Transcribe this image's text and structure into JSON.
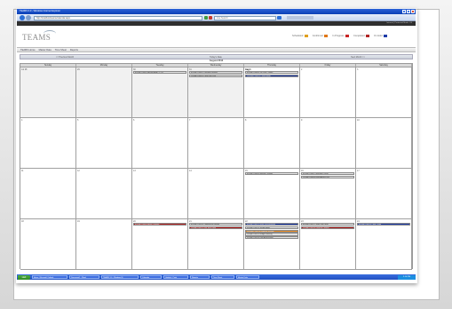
{
  "window": {
    "title": "TEAMS 3.0 - Windows Internet Explorer",
    "url": "http://localhost/teams/calendar.aspx",
    "search_placeholder": "Live Search",
    "status_text": "Internet | Protected Mode: Off"
  },
  "app": {
    "logo": "TEAMS",
    "nav": [
      "TEAMS Home",
      "Master Data",
      "Time Sheet",
      "Reports"
    ],
    "legend": [
      {
        "label": "Scheduled",
        "color": "#e0a020"
      },
      {
        "label": "Confirmed",
        "color": "#e07818"
      },
      {
        "label": "In Progress",
        "color": "#c82424"
      },
      {
        "label": "Completed",
        "color": "#b02424"
      },
      {
        "label": "On Hold",
        "color": "#1f3ca8"
      }
    ]
  },
  "calendar": {
    "prev_label": "<< Previous Month",
    "today_label": "Today's Date",
    "next_label": "Next Month >>",
    "month_title": "August 2013",
    "days": [
      "Sunday",
      "Monday",
      "Tuesday",
      "Wednesday",
      "Thursday",
      "Friday",
      "Saturday"
    ],
    "weeks": [
      {
        "cells": [
          {
            "num": "Jul 28",
            "other": true,
            "events": []
          },
          {
            "num": "29",
            "other": true,
            "events": []
          },
          {
            "num": "30",
            "other": true,
            "events": [
              {
                "text": "8:00am 100001 Annual Audit - FY12",
                "color": "gray"
              }
            ]
          },
          {
            "num": "31",
            "other": true,
            "events": [
              {
                "text": "8:00am 100002 Quarterly Review",
                "color": "gray"
              },
              {
                "text": "1:00pm 100003 Client Site Visit",
                "color": "gray"
              }
            ]
          },
          {
            "num": "Aug 1",
            "today": true,
            "events": [
              {
                "text": "8:00am 100004 Tax Prep - Smith",
                "color": "gray"
              },
              {
                "text": "10:00am 100005 Payroll Audit",
                "color": "blue"
              }
            ]
          },
          {
            "num": "2",
            "events": []
          },
          {
            "num": "3",
            "events": []
          }
        ]
      },
      {
        "cells": [
          {
            "num": "4",
            "events": []
          },
          {
            "num": "5",
            "events": []
          },
          {
            "num": "6",
            "events": []
          },
          {
            "num": "7",
            "events": []
          },
          {
            "num": "8",
            "events": []
          },
          {
            "num": "9",
            "events": []
          },
          {
            "num": "10",
            "events": []
          }
        ]
      },
      {
        "cells": [
          {
            "num": "11",
            "events": []
          },
          {
            "num": "12",
            "events": []
          },
          {
            "num": "13",
            "events": []
          },
          {
            "num": "14",
            "events": []
          },
          {
            "num": "15",
            "events": [
              {
                "text": "8:00am 100006 Internal Controls",
                "color": "gray"
              }
            ]
          },
          {
            "num": "16",
            "events": [
              {
                "text": "8:00am 100007 Inventory Count",
                "color": "gray"
              },
              {
                "text": "1:00pm 100008 Fixed Assets Rev",
                "color": "gray"
              }
            ]
          },
          {
            "num": "17",
            "events": []
          }
        ]
      },
      {
        "cells": [
          {
            "num": "18",
            "events": []
          },
          {
            "num": "19",
            "events": []
          },
          {
            "num": "20",
            "events": [
              {
                "text": "8:00am 100009 Audit Planning",
                "color": "red"
              }
            ]
          },
          {
            "num": "21",
            "events": [
              {
                "text": "8:00am 100010 Compliance Review",
                "color": "gray"
              },
              {
                "text": "1:00pm 100011 Year End Close",
                "color": "red"
              }
            ]
          },
          {
            "num": "22",
            "events": [
              {
                "text": "8:00am 100012 Bank Reconciliation",
                "color": "blue"
              },
              {
                "text": "9:00am 100013 Vendor Audit",
                "color": "gray"
              },
              {
                "text": "10:00am 100014 Expense Review",
                "color": "orange"
              },
              {
                "text": "1:00pm 100015 Budget Meeting",
                "color": "gray"
              },
              {
                "text": "3:00pm 100016 Risk Assessment",
                "color": "gray"
              }
            ]
          },
          {
            "num": "23",
            "events": [
              {
                "text": "8:00am 100017 Sales Tax Filing",
                "color": "gray"
              },
              {
                "text": "1:00pm 100018 Revenue Testing",
                "color": "red"
              }
            ]
          },
          {
            "num": "24",
            "events": [
              {
                "text": "8:00am 100019 Cash Count",
                "color": "blue"
              }
            ]
          }
        ]
      }
    ]
  },
  "taskbar": {
    "start_label": "start",
    "tasks": [
      "Inbox - Microsoft Outlook",
      "Document1 - Word",
      "TEAMS 3.0 - Windows IE",
      "Calendar",
      "Untitled - Paint",
      "Reports",
      "Time Sheet",
      "Master Data"
    ],
    "clock": "2:14 PM"
  }
}
